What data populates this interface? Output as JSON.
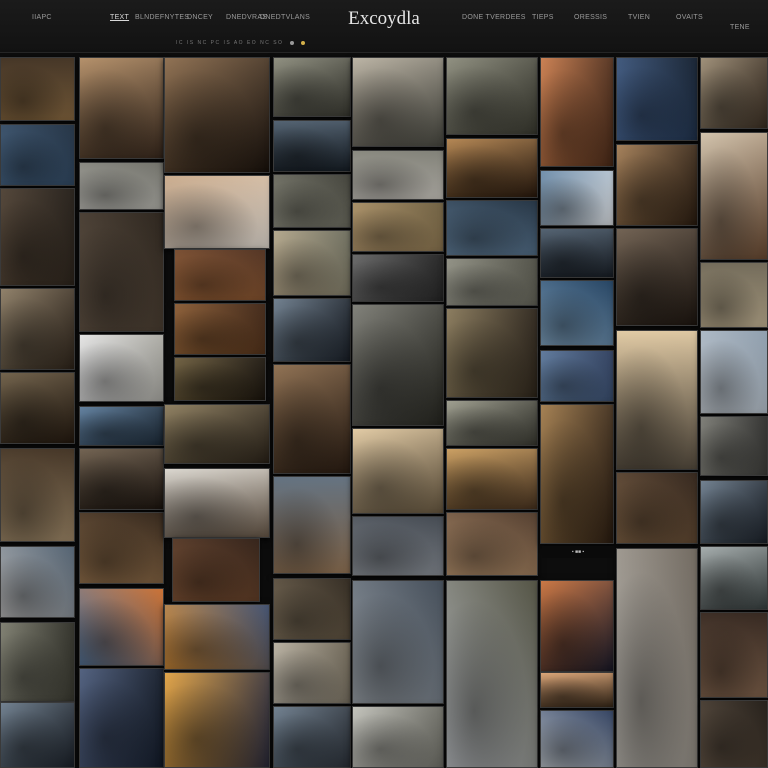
{
  "header": {
    "brand": "Excoydla",
    "left_code": "IIAPC",
    "left_nav": [
      "TEXT",
      "BLNDEFNYTES",
      "DNCEY",
      "DNEDVRAS",
      "DNEDTVLANS"
    ],
    "right_nav": [
      "DONE TVERDEES",
      "TIEPS",
      "ORESSIS",
      "TVIEN",
      "OVAITS"
    ],
    "right_code": "TENE",
    "sub_items": [
      "IC",
      "IS",
      "NC",
      "PC",
      "IS",
      "AO",
      "EO",
      "NC",
      "SO"
    ]
  },
  "gallery": {
    "caption": "▪ ■■ ▪"
  }
}
